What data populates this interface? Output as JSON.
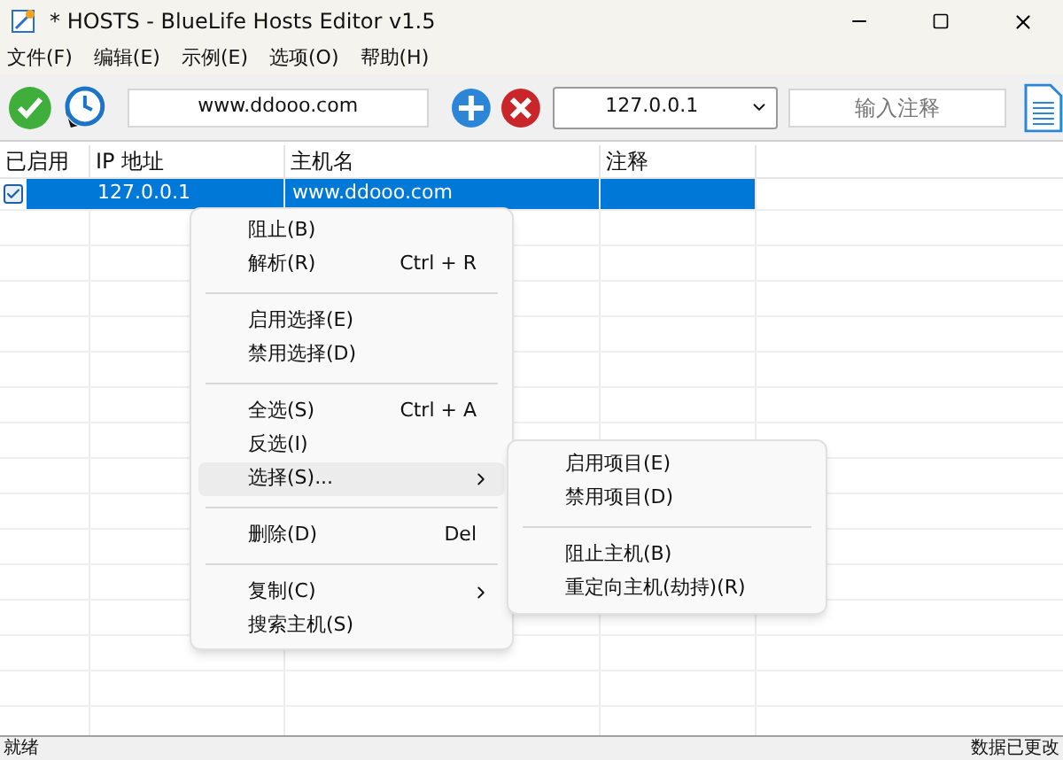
{
  "window": {
    "title": "* HOSTS - BlueLife Hosts Editor v1.5"
  },
  "menu_bar": [
    "文件(F)",
    "编辑(E)",
    "示例(E)",
    "选项(O)",
    "帮助(H)"
  ],
  "toolbar": {
    "host_field": {
      "value": "www.ddooo.com"
    },
    "ip_combo": {
      "value": "127.0.0.1"
    },
    "comment_field": {
      "placeholder": "输入注释"
    }
  },
  "table": {
    "columns": [
      "已启用",
      "IP 地址",
      "主机名",
      "注释"
    ],
    "rows": [
      {
        "enabled": true,
        "selected": true,
        "ip": "127.0.0.1",
        "host": "www.ddooo.com",
        "comment": ""
      }
    ]
  },
  "context_menu": {
    "items": [
      {
        "kind": "item",
        "label": "阻止(B)",
        "selected": false
      },
      {
        "kind": "item",
        "label": "解析(R)",
        "shortcut": "Ctrl + R",
        "selected": false
      },
      {
        "kind": "separator"
      },
      {
        "kind": "item",
        "label": "启用选择(E)",
        "selected": false
      },
      {
        "kind": "item",
        "label": "禁用选择(D)",
        "selected": false
      },
      {
        "kind": "separator"
      },
      {
        "kind": "item",
        "label": "全选(S)",
        "shortcut": "Ctrl + A",
        "selected": false
      },
      {
        "kind": "item",
        "label": "反选(I)",
        "selected": false
      },
      {
        "kind": "item",
        "label": "选择(S)...",
        "submenu": true,
        "selected": true
      },
      {
        "kind": "separator"
      },
      {
        "kind": "item",
        "label": "删除(D)",
        "shortcut": "Del",
        "selected": false
      },
      {
        "kind": "separator"
      },
      {
        "kind": "item",
        "label": "复制(C)",
        "submenu": true,
        "selected": false
      },
      {
        "kind": "item",
        "label": "搜索主机(S)",
        "selected": false
      }
    ]
  },
  "submenu": {
    "items": [
      {
        "kind": "item",
        "label": "启用项目(E)",
        "selected": false
      },
      {
        "kind": "item",
        "label": "禁用项目(D)",
        "selected": false
      },
      {
        "kind": "separator"
      },
      {
        "kind": "item",
        "label": "阻止主机(B)",
        "selected": false
      },
      {
        "kind": "item",
        "label": "重定向主机(劫持)(R)",
        "selected": false
      }
    ]
  },
  "status_bar": {
    "left": "就绪",
    "right": "数据已更改"
  }
}
